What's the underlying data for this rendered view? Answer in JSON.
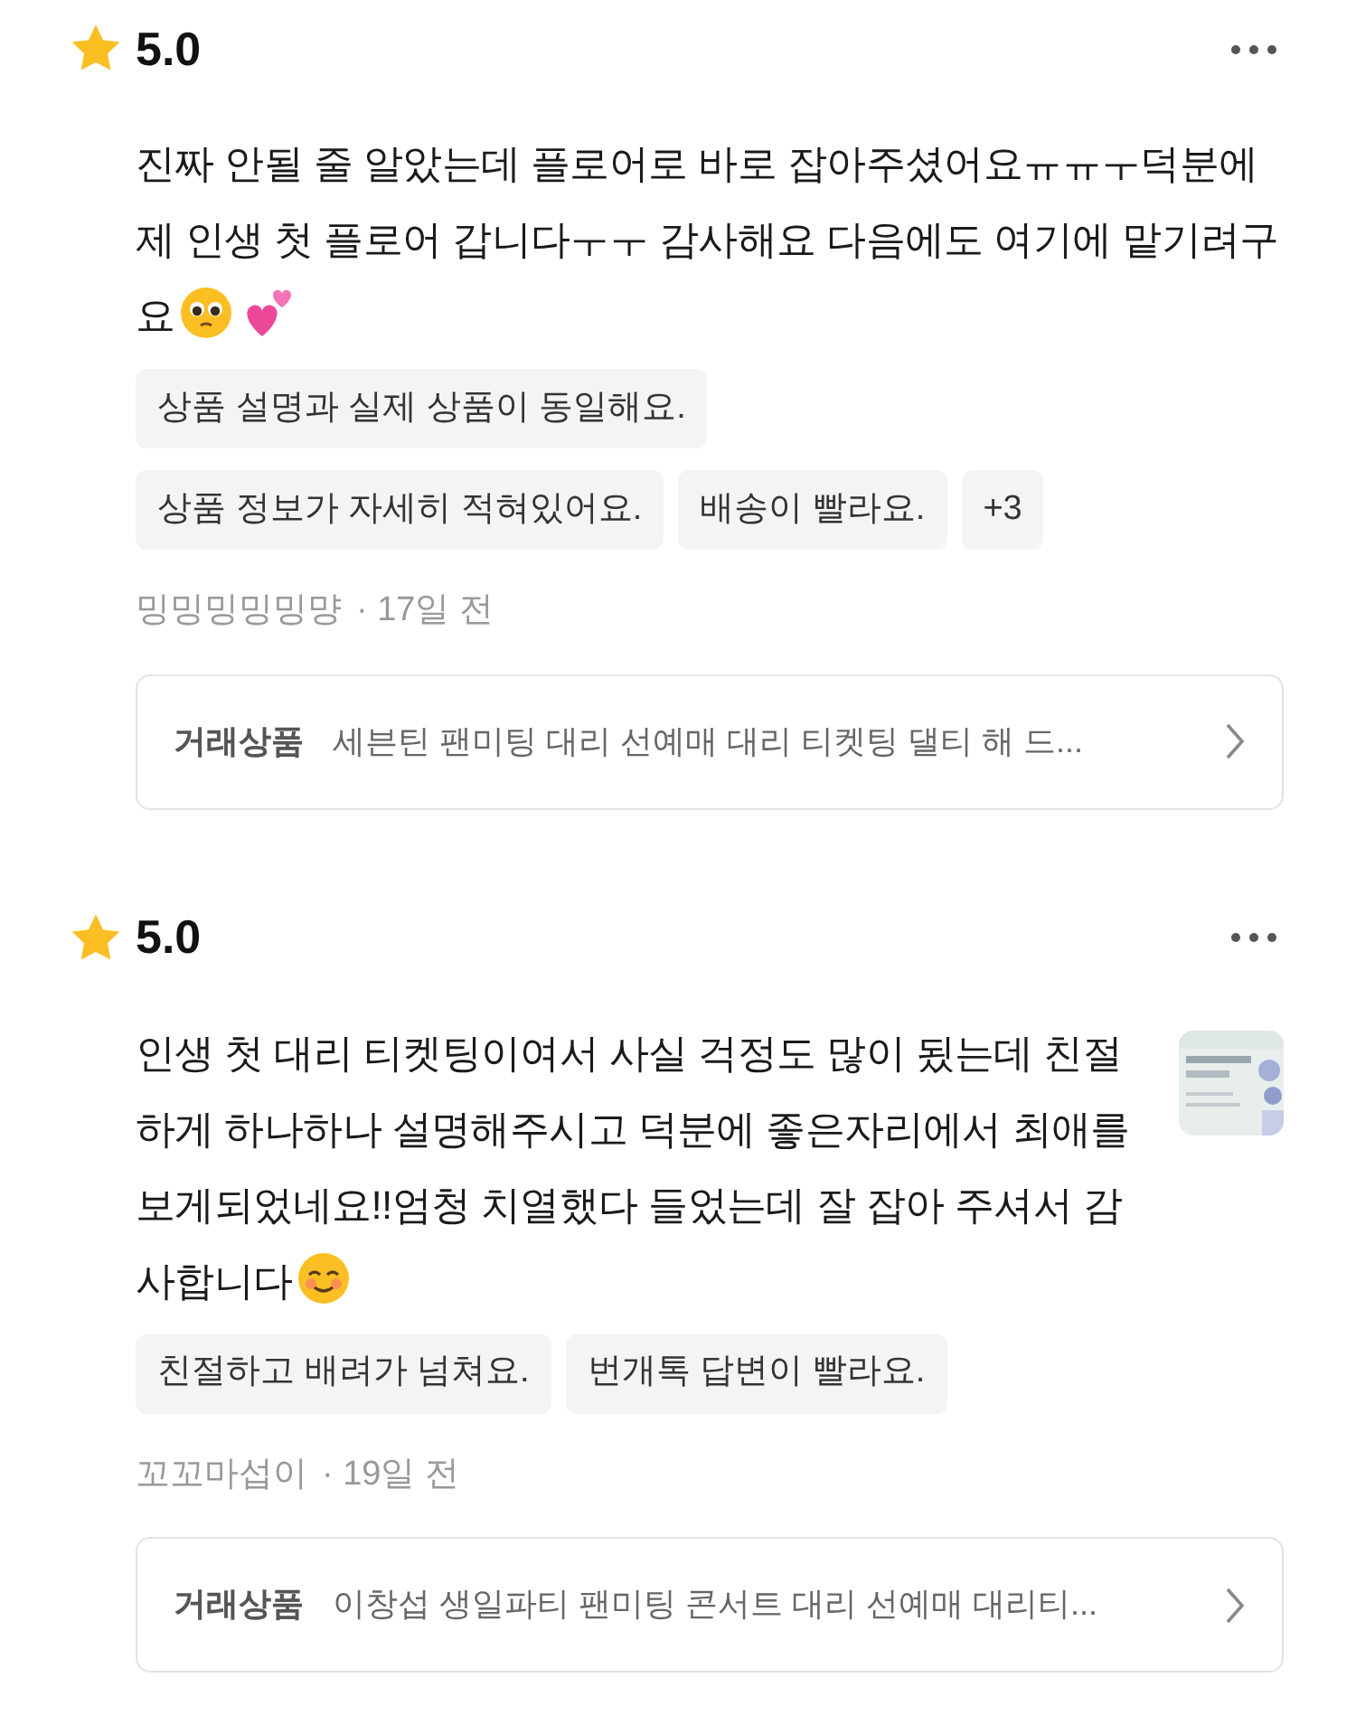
{
  "reviews": [
    {
      "rating": "5.0",
      "text": "진짜 안될 줄 알았는데 플로어로 바로 잡아주셨어요ㅠㅠㅜ덕분에 제 인생 첫 플로어 갑니다ㅜㅜ 감사해요 다음에도 여기에 맡기려구요",
      "trailing_icons": [
        {
          "kind": "pleading"
        },
        {
          "kind": "hearts"
        }
      ],
      "tag_rows": [
        [
          "상품 설명과 실제 상품이 동일해요."
        ],
        [
          "상품 정보가 자세히 적혀있어요.",
          "배송이 빨라요.",
          "+3"
        ]
      ],
      "author": "밍밍밍밍밍먕",
      "date": "· 17일 전",
      "product_label": "거래상품",
      "product_title": "세븐틴 팬미팅 대리 선예매 대리 티켓팅 댈티 해 드..."
    },
    {
      "rating": "5.0",
      "text": "인생 첫 대리 티켓팅이여서 사실 걱정도 많이 됬는데 친절하게 하나하나 설명해주시고 덕분에 좋은자리에서 최애를 보게되었네요!!엄청 치열했다 들었는데 잘 잡아 주셔서 감사합니다",
      "trailing_icons": [
        {
          "kind": "smiling"
        }
      ],
      "photo": {
        "kind": "picture"
      },
      "tag_rows": [
        [
          "친절하고 배려가 넘쳐요.",
          "번개톡 답변이 빨라요."
        ]
      ],
      "author": "꼬꼬마섭이",
      "date": "· 19일 전",
      "product_label": "거래상품",
      "product_title": "이창섭 생일파티 팬미팅 콘서트 대리 선예매 대리티..."
    }
  ]
}
